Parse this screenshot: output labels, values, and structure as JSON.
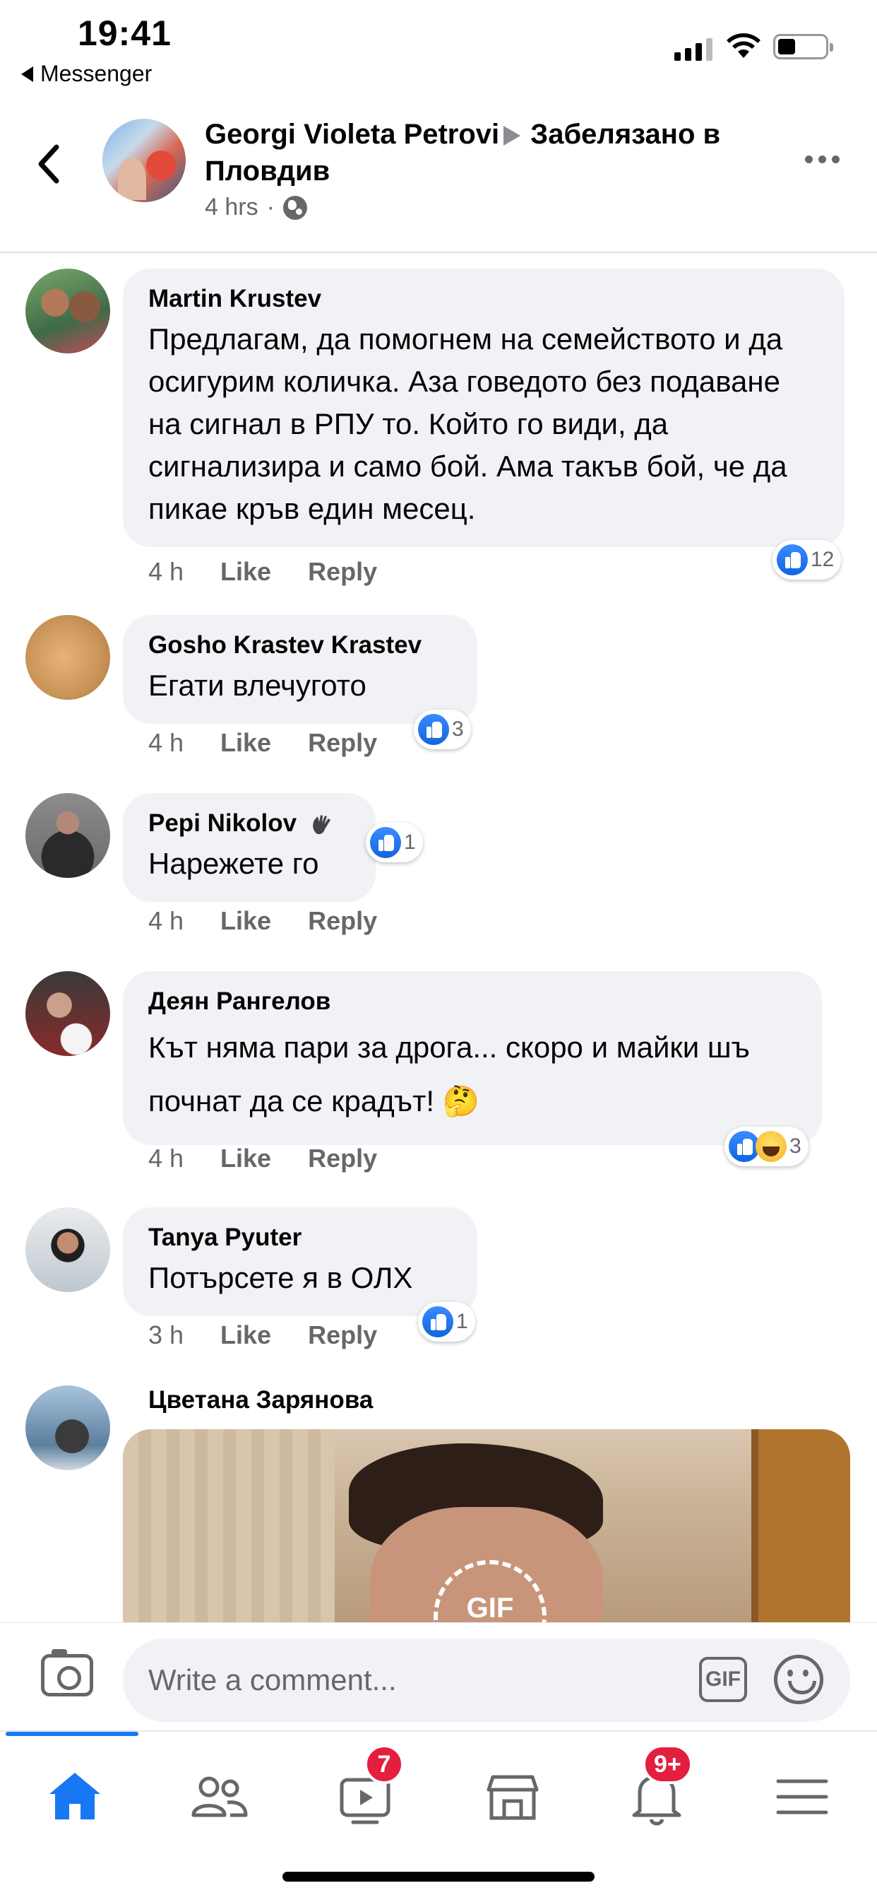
{
  "status_bar": {
    "time": "19:41",
    "back_app": "Messenger"
  },
  "post_header": {
    "author": "Georgi Violeta Petrovi",
    "location_text": "Забелязано в Пловдив",
    "time": "4 hrs",
    "separator": "·",
    "privacy_icon": "globe-icon"
  },
  "comments": [
    {
      "author": "Martin Krustev",
      "text": "Предлагам, да помогнем на семейството и да осигурим количка. Аза говедото без подаване на сигнал в РПУ то. Който го види, да сигнализира и само бой. Ама такъв бой, че да пикае кръв един месец.",
      "time": "4 h",
      "like_label": "Like",
      "reply_label": "Reply",
      "reaction_count": "12",
      "reactions": [
        "like"
      ]
    },
    {
      "author": "Gosho Krastev Krastev",
      "text": "Егати влечугото",
      "time": "4 h",
      "like_label": "Like",
      "reply_label": "Reply",
      "reaction_count": "3",
      "reactions": [
        "like"
      ]
    },
    {
      "author": "Pepi Nikolov",
      "author_badge_icon": "waving-hand-icon",
      "text": "Нарежете го",
      "time": "4 h",
      "like_label": "Like",
      "reply_label": "Reply",
      "reaction_count": "1",
      "reactions": [
        "like"
      ]
    },
    {
      "author": "Деян Рангелов",
      "text": "Кът няма пари за дрога... скоро и майки шъ почнат да се крадът! 🤔",
      "time": "4 h",
      "like_label": "Like",
      "reply_label": "Reply",
      "reaction_count": "3",
      "reactions": [
        "like",
        "haha"
      ]
    },
    {
      "author": "Tanya Pyuter",
      "text": "Потърсете я в ОЛХ",
      "time": "3 h",
      "like_label": "Like",
      "reply_label": "Reply",
      "reaction_count": "1",
      "reactions": [
        "like"
      ]
    },
    {
      "author": "Цветана Зарянова",
      "attachment_badge": "GIF"
    }
  ],
  "composer": {
    "placeholder": "Write a comment...",
    "gif_label": "GIF"
  },
  "tabbar": {
    "tabs": [
      "home-tab",
      "friends-tab",
      "watch-tab",
      "marketplace-tab",
      "notifications-tab",
      "menu-tab"
    ],
    "watch_badge": "7",
    "notifications_badge": "9+",
    "active_color": "#1877f2",
    "inactive_color": "#65676b"
  },
  "colors": {
    "accent": "#1877f2",
    "bubble": "#f0f2f5",
    "secondary_text": "#65676b",
    "badge": "#e41e3f"
  }
}
